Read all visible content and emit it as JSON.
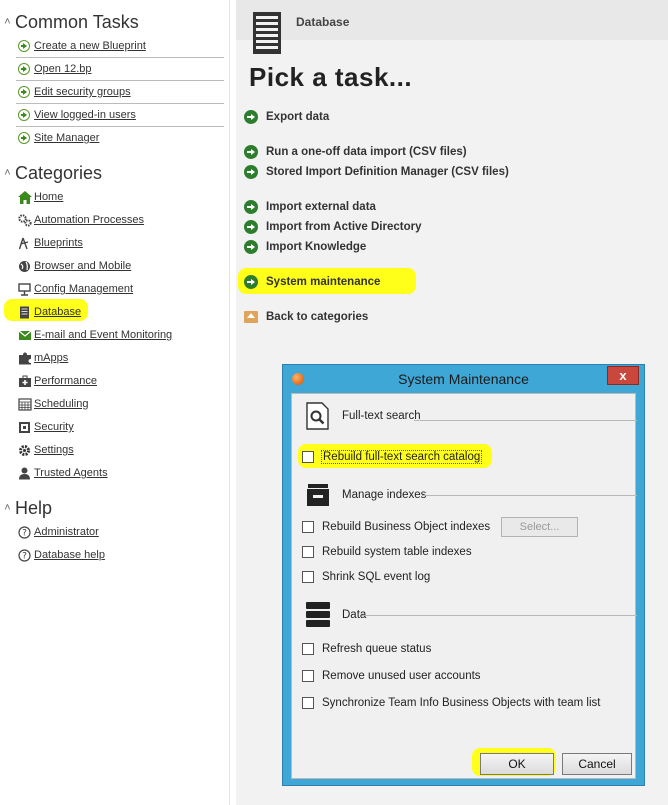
{
  "sidebar": {
    "common_tasks": {
      "title": "Common Tasks",
      "items": [
        {
          "label": "Create a new Blueprint",
          "icon": "green-arrow-icon"
        },
        {
          "label": "Open 12.bp",
          "icon": "green-arrow-icon"
        },
        {
          "label": "Edit security groups",
          "icon": "green-arrow-icon"
        },
        {
          "label": "View logged-in users",
          "icon": "green-arrow-icon"
        },
        {
          "label": "Site Manager",
          "icon": "green-arrow-icon"
        }
      ]
    },
    "categories": {
      "title": "Categories",
      "items": [
        {
          "label": "Home",
          "icon": "home-icon"
        },
        {
          "label": "Automation Processes",
          "icon": "gears-icon"
        },
        {
          "label": "Blueprints",
          "icon": "compass-icon"
        },
        {
          "label": "Browser and Mobile",
          "icon": "globe-icon"
        },
        {
          "label": "Config Management",
          "icon": "config-icon"
        },
        {
          "label": "Database",
          "icon": "database-icon"
        },
        {
          "label": "E-mail and Event Monitoring",
          "icon": "email-icon"
        },
        {
          "label": "mApps",
          "icon": "puzzle-icon"
        },
        {
          "label": "Performance",
          "icon": "medkit-icon"
        },
        {
          "label": "Scheduling",
          "icon": "calendar-icon"
        },
        {
          "label": "Security",
          "icon": "lock-icon"
        },
        {
          "label": "Settings",
          "icon": "gear-icon"
        },
        {
          "label": "Trusted Agents",
          "icon": "agent-icon"
        }
      ]
    },
    "help": {
      "title": "Help",
      "items": [
        {
          "label": "Administrator",
          "icon": "question-icon"
        },
        {
          "label": "Database help",
          "icon": "question-icon"
        }
      ]
    }
  },
  "main": {
    "breadcrumb": "Database",
    "heading": "Pick a task...",
    "tasks": [
      {
        "label": "Export data"
      },
      {
        "label": "Run a one-off data import (CSV files)"
      },
      {
        "label": "Stored Import Definition Manager (CSV files)"
      },
      {
        "label": "Import external data"
      },
      {
        "label": "Import from Active Directory"
      },
      {
        "label": "Import Knowledge"
      },
      {
        "label": "System maintenance"
      },
      {
        "label": "Back to categories"
      }
    ]
  },
  "dialog": {
    "title": "System Maintenance",
    "close_label": "x",
    "groups": {
      "fulltext": "Full-text search",
      "indexes": "Manage indexes",
      "data": "Data"
    },
    "options": {
      "rebuild_fulltext": "Rebuild full-text search catalog",
      "rebuild_bo_indexes": "Rebuild Business Object indexes",
      "select_button": "Select...",
      "rebuild_system_indexes": "Rebuild system table indexes",
      "shrink_sql_log": "Shrink SQL event log",
      "refresh_queue": "Refresh queue status",
      "remove_unused_accounts": "Remove unused user accounts",
      "sync_team_info": "Synchronize Team Info Business Objects with team list"
    },
    "ok_label": "OK",
    "cancel_label": "Cancel"
  },
  "colors": {
    "highlight": "#ffff1a",
    "accent_green": "#2e7d2e",
    "dialog_frame": "#3fa7d6",
    "close_red": "#c9473c"
  }
}
